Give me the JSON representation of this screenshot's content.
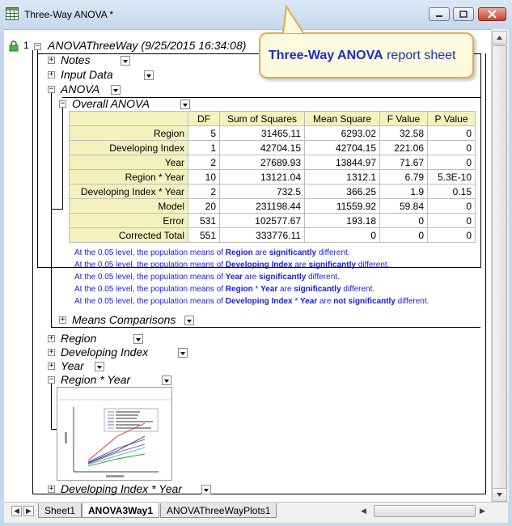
{
  "window": {
    "title": "Three-Way ANOVA *"
  },
  "callout": {
    "bold": "Three-Way ANOVA",
    "rest": " report sheet"
  },
  "tree": {
    "row_number": "1",
    "root_label": "ANOVAThreeWay (9/25/2015 16:34:08)",
    "notes": "Notes",
    "input_data": "Input Data",
    "anova": "ANOVA",
    "overall_anova": "Overall ANOVA",
    "means_comparisons": "Means Comparisons",
    "region": "Region",
    "developing_index": "Developing Index",
    "year": "Year",
    "region_year": "Region * Year",
    "developing_index_year": "Developing Index * Year"
  },
  "table": {
    "headers": [
      "DF",
      "Sum of Squares",
      "Mean Square",
      "F Value",
      "P Value"
    ],
    "rows": [
      {
        "label": "Region",
        "cells": [
          "5",
          "31465.11",
          "6293.02",
          "32.58",
          "0"
        ]
      },
      {
        "label": "Developing Index",
        "cells": [
          "1",
          "42704.15",
          "42704.15",
          "221.06",
          "0"
        ]
      },
      {
        "label": "Year",
        "cells": [
          "2",
          "27689.93",
          "13844.97",
          "71.67",
          "0"
        ]
      },
      {
        "label": "Region * Year",
        "cells": [
          "10",
          "13121.04",
          "1312.1",
          "6.79",
          "5.3E-10"
        ]
      },
      {
        "label": "Developing Index * Year",
        "cells": [
          "2",
          "732.5",
          "366.25",
          "1.9",
          "0.15"
        ]
      },
      {
        "label": "Model",
        "cells": [
          "20",
          "231198.44",
          "11559.92",
          "59.84",
          "0"
        ]
      },
      {
        "label": "Error",
        "cells": [
          "531",
          "102577.67",
          "193.18",
          "0",
          "0"
        ]
      },
      {
        "label": "Corrected Total",
        "cells": [
          "551",
          "333776.11",
          "0",
          "0",
          "0"
        ]
      }
    ]
  },
  "notes": {
    "n1": {
      "a": "At the 0.05 level, the population means of ",
      "b": "Region",
      "c": " are ",
      "d": "significantly",
      "e": " different."
    },
    "n2": {
      "a": "At the 0.05 level, the population means of ",
      "b": "Developing Index",
      "c": " are ",
      "d": "significantly",
      "e": " different."
    },
    "n3": {
      "a": "At the 0.05 level, the population means of ",
      "b": "Year",
      "c": " are ",
      "d": "significantly",
      "e": " different."
    },
    "n4": {
      "a": "At the 0.05 level, the population means of ",
      "b": "Region",
      "c": " * ",
      "b2": "Year",
      "c2": " are ",
      "d": "significantly",
      "e": " different."
    },
    "n5": {
      "a": "At the 0.05 level, the population means of ",
      "b": "Developing Index",
      "c": " * ",
      "b2": "Year",
      "c2": " are ",
      "d": "not significantly",
      "e": " different."
    }
  },
  "sheet_tabs": {
    "t1": "Sheet1",
    "t2": "ANOVA3Way1",
    "t3": "ANOVAThreeWayPlots1"
  },
  "colors": {
    "accent_text": "#1c2fc9",
    "note_text": "#1a1ae6",
    "header_fill": "#f4f1bd",
    "callout_border": "#e6a845",
    "callout_fill": "#fff9dd"
  }
}
